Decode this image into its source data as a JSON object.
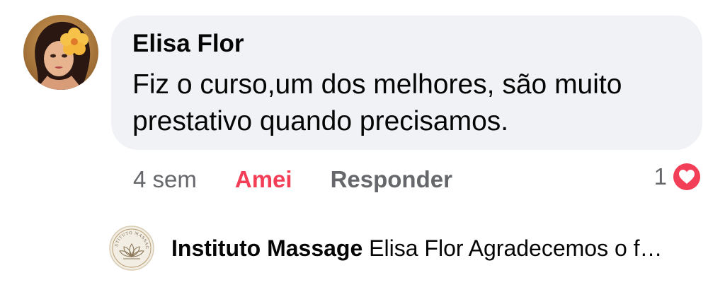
{
  "comment": {
    "author": "Elisa Flor",
    "text": "Fiz o curso,um dos melhores, são muito prestativo quando precisamos.",
    "time": "4 sem",
    "love_label": "Amei",
    "reply_label": "Responder",
    "reaction_count": "1",
    "reaction_icon": "heart-icon"
  },
  "reply": {
    "author": "Instituto Massage",
    "preview": "Elisa Flor Agradecemos o f…",
    "avatar_logo_text": "INSTITUTO MASSAGE"
  },
  "colors": {
    "bubble": "#f0f2f5",
    "love": "#f33e58",
    "secondary_text": "#65676b",
    "primary_text": "#050505"
  }
}
